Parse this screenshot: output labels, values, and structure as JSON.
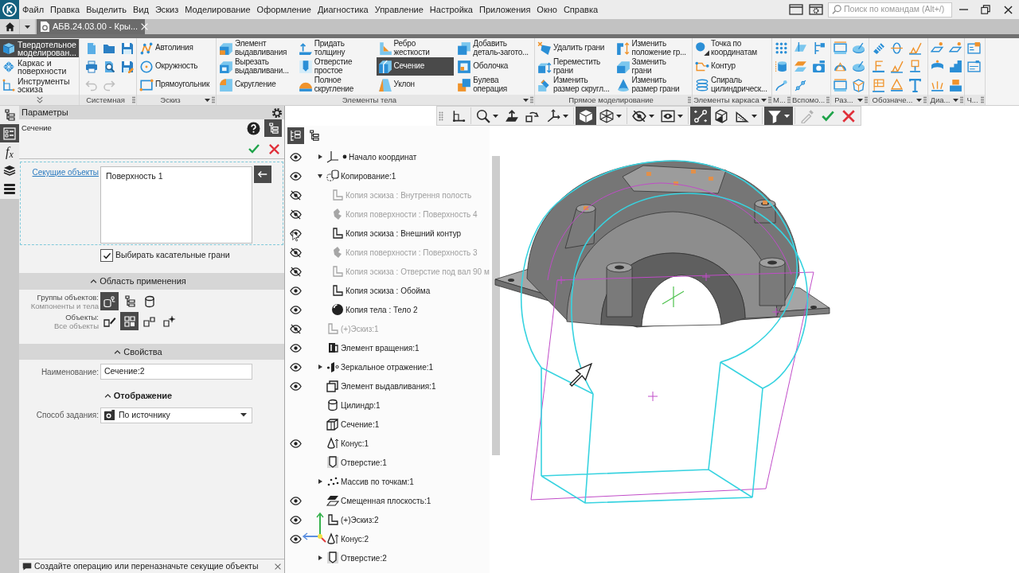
{
  "menu": [
    "Файл",
    "Правка",
    "Выделить",
    "Вид",
    "Эскиз",
    "Моделирование",
    "Оформление",
    "Диагностика",
    "Управление",
    "Настройка",
    "Приложения",
    "Окно",
    "Справка"
  ],
  "search": {
    "placeholder": "Поиск по командам (Alt+/)"
  },
  "tabs": [
    {
      "label": "АБВ.24.03.00 - Кры...",
      "selected": true
    }
  ],
  "ribbon": {
    "modes": [
      {
        "label": "Твердотельное\nмоделирован...",
        "selected": true
      },
      {
        "label": "Каркас и\nповерхности",
        "selected": false
      },
      {
        "label": "Инструменты\nэскиза",
        "selected": false
      }
    ],
    "groups": [
      {
        "kind": "system",
        "label": "Системная",
        "has_menu": false,
        "buttons": [
          {
            "disabled": false
          },
          {
            "disabled": false
          },
          {
            "disabled": false
          },
          {
            "disabled": false
          },
          {
            "disabled": false
          },
          {
            "disabled": false
          },
          {
            "disabled": true
          },
          {
            "disabled": true
          }
        ]
      },
      {
        "kind": "commands",
        "label": "Эскиз",
        "has_menu": true,
        "columns": [
          [
            {
              "label": "Автолиния",
              "selected": false
            },
            {
              "label": "Окружность",
              "selected": false
            },
            {
              "label": "Прямоугольник",
              "selected": false
            }
          ]
        ]
      },
      {
        "kind": "commands",
        "label": "Элементы тела",
        "has_menu": true,
        "columns": [
          [
            {
              "label": "Элемент\nвыдавливания",
              "selected": false
            },
            {
              "label": "Вырезать\nвыдавливани...",
              "selected": false
            },
            {
              "label": "Скругление",
              "selected": false
            }
          ],
          [
            {
              "label": "Придать\nтолщину",
              "selected": false
            },
            {
              "label": "Отверстие\nпростое",
              "selected": false
            },
            {
              "label": "Полное\nскругление",
              "selected": false
            }
          ],
          [
            {
              "label": "Ребро\nжесткости",
              "selected": false
            },
            {
              "label": "Сечение",
              "selected": true
            },
            {
              "label": "Уклон",
              "selected": false
            }
          ],
          [
            {
              "label": "Добавить\nдеталь-загото...",
              "selected": false
            },
            {
              "label": "Оболочка",
              "selected": false
            },
            {
              "label": "Булева\nоперация",
              "selected": false
            }
          ]
        ]
      },
      {
        "kind": "commands",
        "label": "Прямое моделирование",
        "has_menu": false,
        "columns": [
          [
            {
              "label": "Удалить грани",
              "selected": false
            },
            {
              "label": "Переместить\nграни",
              "selected": false
            },
            {
              "label": "Изменить\nразмер скругл...",
              "selected": false
            }
          ],
          [
            {
              "label": "Изменить\nположение гр...",
              "selected": false
            },
            {
              "label": "Заменить\nграни",
              "selected": false
            },
            {
              "label": "Изменить\nразмер грани",
              "selected": false
            }
          ]
        ]
      },
      {
        "kind": "commands",
        "label": "Элементы каркаса",
        "has_menu": true,
        "columns": [
          [
            {
              "label": "Точка по\nкоординатам",
              "selected": false
            },
            {
              "label": "Контур",
              "selected": false
            },
            {
              "label": "Спираль\nцилиндрическ...",
              "selected": false
            }
          ]
        ]
      },
      {
        "kind": "icons",
        "label": "М...",
        "has_menu": false
      },
      {
        "kind": "icons",
        "label": "Вспомо...",
        "has_menu": false
      },
      {
        "kind": "icons",
        "label": "Раз...",
        "has_menu": true
      },
      {
        "kind": "icons",
        "label": "Обозначе...",
        "has_menu": true
      },
      {
        "kind": "icons",
        "label": "Диа...",
        "has_menu": true
      },
      {
        "kind": "icons",
        "label": "Ч...",
        "has_menu": false
      }
    ]
  },
  "side_tabs": [
    {
      "selected": false
    },
    {
      "selected": true
    },
    {
      "label": "f$_{x}$",
      "selected": false
    },
    {
      "selected": false
    },
    {
      "selected": false
    }
  ],
  "parameters": {
    "title": "Параметры",
    "operation": "Сечение",
    "tree_button": {
      "selected": true
    },
    "cutting": {
      "label": "Секущие объекты",
      "items": [
        "Поверхность 1"
      ]
    },
    "tangent": {
      "label": "Выбирать касательные грани",
      "checked": true
    },
    "scope": {
      "title": "Область применения",
      "expanded": true,
      "rows": [
        {
          "label": "Группы объектов:",
          "value": "Компоненты и тела",
          "options": [
            {
              "selected": true
            },
            {
              "selected": false
            },
            {
              "selected": false
            }
          ]
        },
        {
          "label": "Объекты:",
          "value": "Все объекты",
          "options": [
            {
              "selected": false
            },
            {
              "selected": true
            },
            {
              "selected": false
            },
            {
              "selected": false
            }
          ]
        }
      ]
    },
    "properties": {
      "title": "Свойства",
      "expanded": true,
      "name_label": "Наименование:",
      "name_value": "Сечение:2"
    },
    "display": {
      "title": "Отображение",
      "expanded": true,
      "method_label": "Способ задания:",
      "method_value": "По источнику"
    }
  },
  "status": {
    "message": "Создайте операцию или переназначьте секущие объекты"
  },
  "view_toolbar": [
    {
      "selected": false,
      "disabled": false
    },
    {
      "selected": false,
      "disabled": false
    },
    {
      "selected": false,
      "disabled": false
    },
    {
      "selected": false,
      "disabled": false
    },
    {
      "selected": false,
      "disabled": false
    },
    {
      "selected": true,
      "disabled": false
    },
    {
      "selected": false,
      "disabled": false
    },
    {
      "selected": false,
      "disabled": false
    },
    {
      "selected": false,
      "disabled": false
    },
    {
      "selected": true,
      "disabled": false
    },
    {
      "selected": false,
      "disabled": false
    },
    {
      "selected": false,
      "disabled": false
    },
    {
      "selected": true,
      "disabled": false
    },
    {
      "selected": false,
      "disabled": true
    },
    {
      "selected": false,
      "disabled": false
    },
    {
      "selected": false,
      "disabled": false
    }
  ],
  "tree_toolbar": [
    {
      "selected": true
    },
    {
      "selected": false
    }
  ],
  "tree": {
    "items": [
      {
        "kind": "origin",
        "label": "Начало координат",
        "visible": true,
        "expanded": false
      },
      {
        "kind": "copy",
        "label": "Копирование:1",
        "visible": true,
        "expanded": true,
        "children": [
          {
            "kind": "sketch",
            "label": "Копия эскиза : Внутрення полость",
            "visible": false
          },
          {
            "kind": "surface",
            "label": "Копия поверхности : Поверхность 4",
            "visible": false
          },
          {
            "kind": "sketch",
            "label": "Копия эскиза : Внешний контур",
            "visible": true
          },
          {
            "kind": "surface",
            "label": "Копия поверхности : Поверхность 3",
            "visible": false
          },
          {
            "kind": "sketch",
            "label": "Копия эскиза : Отверстие под вал 90 м",
            "visible": false
          },
          {
            "kind": "sketch",
            "label": "Копия эскиза : Обойма",
            "visible": true
          },
          {
            "kind": "body",
            "label": "Копия тела : Тело 2",
            "visible": true
          }
        ]
      },
      {
        "kind": "sketch",
        "label": "(+)Эскиз:1",
        "visible": false
      },
      {
        "kind": "revolve",
        "label": "Элемент вращения:1",
        "visible": true
      },
      {
        "kind": "mirror",
        "label": "Зеркальное отражение:1",
        "visible": true,
        "expanded": false
      },
      {
        "kind": "extrude",
        "label": "Элемент выдавливания:1",
        "visible": true
      },
      {
        "kind": "cylinder",
        "label": "Цилиндр:1"
      },
      {
        "kind": "section",
        "label": "Сечение:1"
      },
      {
        "kind": "cone",
        "label": "Конус:1",
        "visible": true
      },
      {
        "kind": "hole",
        "label": "Отверстие:1"
      },
      {
        "kind": "array",
        "label": "Массив по точкам:1",
        "expanded": false
      },
      {
        "kind": "plane",
        "label": "Смещенная плоскость:1",
        "visible": true
      },
      {
        "kind": "sketch",
        "label": "(+)Эскиз:2",
        "visible": true
      },
      {
        "kind": "cone",
        "label": "Конус:2",
        "visible": true
      },
      {
        "kind": "hole",
        "label": "Отверстие:2",
        "expanded": false
      }
    ]
  }
}
